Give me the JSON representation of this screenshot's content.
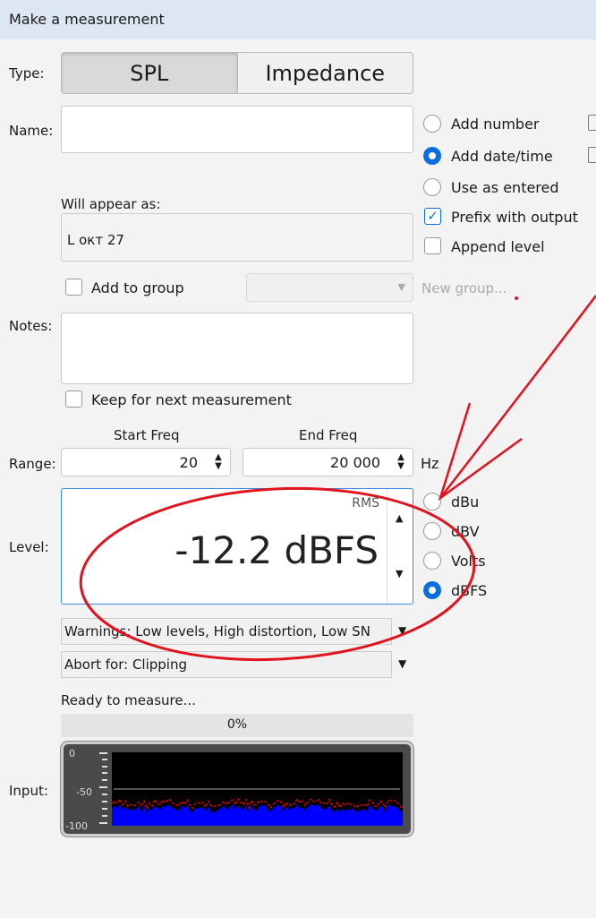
{
  "title": "Make a measurement",
  "type": {
    "label": "Type:",
    "options": [
      "SPL",
      "Impedance"
    ],
    "selected": "SPL"
  },
  "name": {
    "label": "Name:",
    "value": ""
  },
  "naming_options": [
    {
      "label": "Add number",
      "checked": false
    },
    {
      "label": "Add date/time",
      "checked": true
    },
    {
      "label": "Use as entered",
      "checked": false
    }
  ],
  "prefix_with_output": {
    "label": "Prefix with output",
    "checked": true
  },
  "append_level": {
    "label": "Append level",
    "checked": false
  },
  "will_appear": {
    "label": "Will appear as:",
    "value": "L окт 27"
  },
  "group": {
    "label": "Add to group",
    "checked": false,
    "selected": "",
    "new_group": "New group..."
  },
  "notes": {
    "label": "Notes:",
    "value": "",
    "keep_label": "Keep for next measurement",
    "keep_checked": false
  },
  "range": {
    "label": "Range:",
    "start_label": "Start Freq",
    "start": "20",
    "end_label": "End Freq",
    "end": "20 000",
    "unit": "Hz"
  },
  "level": {
    "label": "Level:",
    "mode": "RMS",
    "value": "-12.2 dBFS",
    "units": [
      {
        "label": "dBu",
        "checked": false
      },
      {
        "label": "dBV",
        "checked": false
      },
      {
        "label": "Volts",
        "checked": false
      },
      {
        "label": "dBFS",
        "checked": true
      }
    ]
  },
  "warnings": "Warnings: Low levels, High distortion, Low SN",
  "abort": "Abort for: Clipping",
  "status": "Ready to measure...",
  "progress": {
    "text": "0%",
    "value": 0
  },
  "input": {
    "label": "Input:",
    "ticks": [
      "0",
      "-50",
      "-100"
    ]
  }
}
